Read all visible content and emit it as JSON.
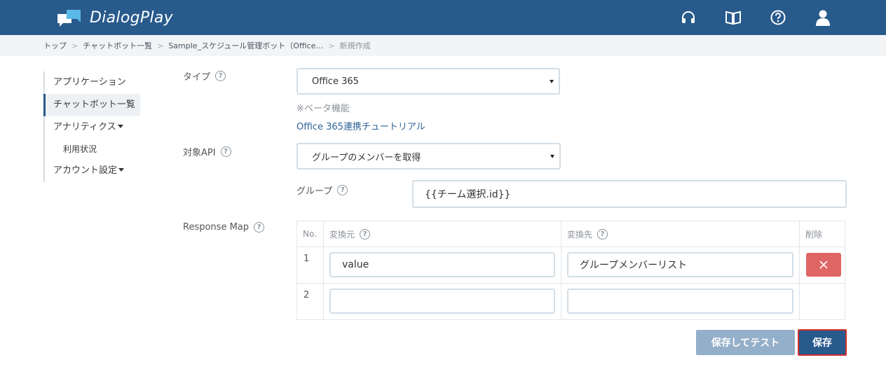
{
  "header": {
    "app_name": "DialogPlay",
    "icons": [
      "headset-icon",
      "book-icon",
      "help-icon",
      "user-icon"
    ],
    "bg_color": "#285a8c"
  },
  "breadcrumb": {
    "items": [
      "トップ",
      "チャットボット一覧",
      "Sample_スケジュール管理ボット（Office…"
    ],
    "current": "新規作成"
  },
  "sidebar": {
    "items": [
      {
        "label": "アプリケーション"
      },
      {
        "label": "チャットボット一覧",
        "active": true
      },
      {
        "label": "アナリティクス"
      },
      {
        "label": "利用状況"
      },
      {
        "label": "アカウント設定"
      }
    ]
  },
  "form": {
    "type_label": "タイプ",
    "type_value": "Office 365",
    "beta_note": "※ベータ機能",
    "tutorial_link": "Office 365連携チュートリアル",
    "api_label": "対象API",
    "api_value": "グループのメンバーを取得",
    "group_label": "グループ",
    "group_value": "{{チーム選択.id}}",
    "response_map_label": "Response Map"
  },
  "response_map": {
    "headers": {
      "no": "No.",
      "source": "変換元",
      "target": "変換先",
      "delete": "削除"
    },
    "rows": [
      {
        "no": "1",
        "source": "value",
        "target": "グループメンバーリスト"
      },
      {
        "no": "2",
        "source": "",
        "target": ""
      }
    ]
  },
  "buttons": {
    "save_and_test": "保存してテスト",
    "save": "保存"
  },
  "help_glyph": "?"
}
